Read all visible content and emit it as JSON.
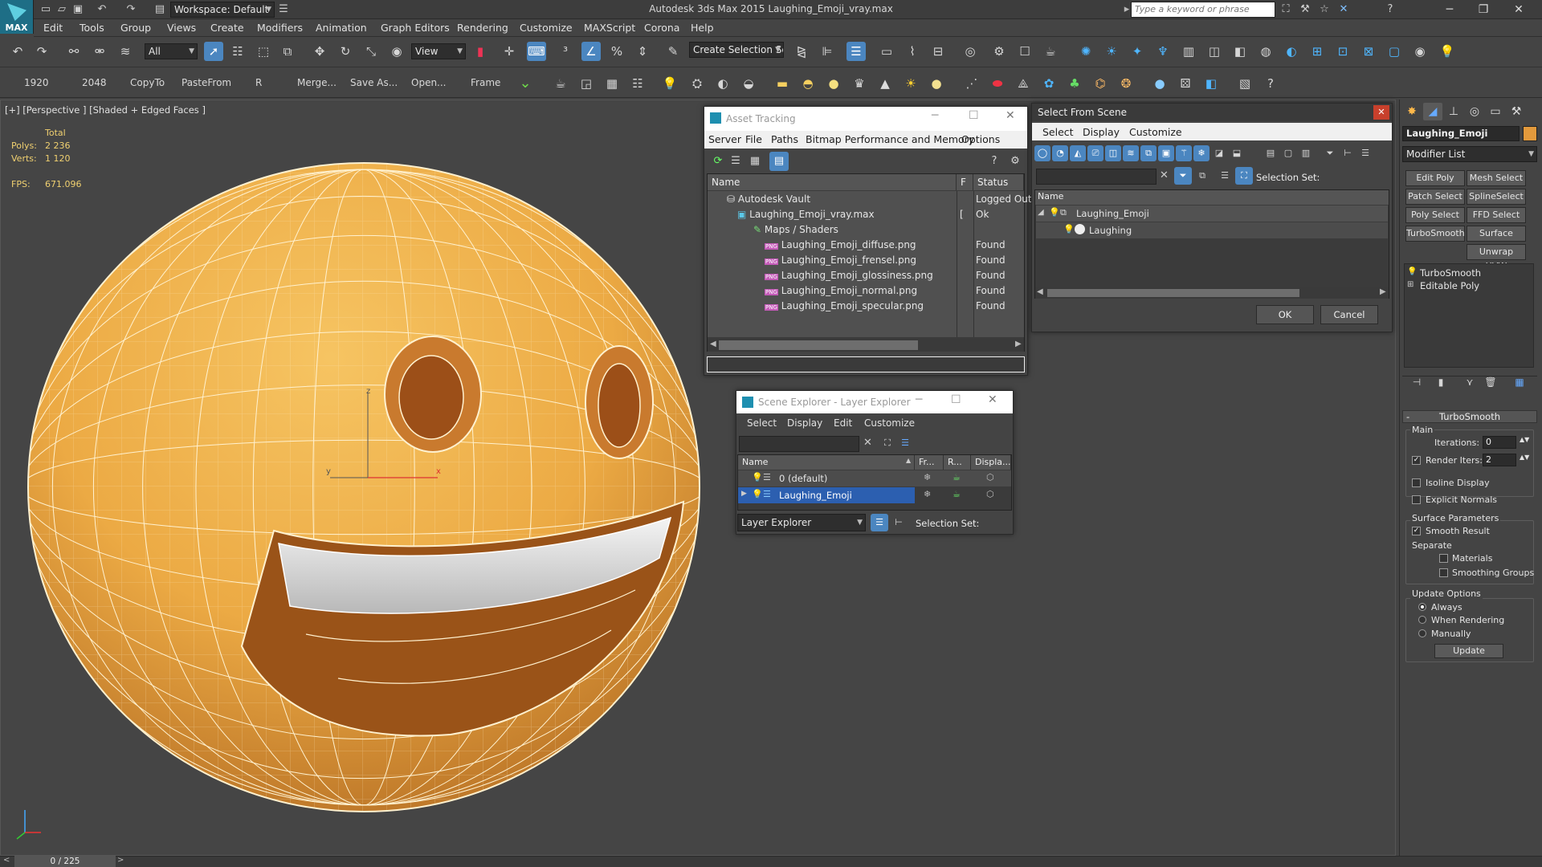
{
  "app": {
    "title": "Autodesk 3ds Max  2015     Laughing_Emoji_vray.max",
    "logo_text": "MAX",
    "workspace": "Workspace: Default",
    "search_placeholder": "Type a keyword or phrase"
  },
  "menu": [
    "Edit",
    "Tools",
    "Group",
    "Views",
    "Create",
    "Modifiers",
    "Animation",
    "Graph Editors",
    "Rendering",
    "Customize",
    "MAXScript",
    "Corona",
    "Help"
  ],
  "main_toolbar": {
    "filter": "All",
    "ref_coord": "View",
    "selection_set": "Create Selection Se"
  },
  "shelf": [
    "1920",
    "2048",
    "CopyTo",
    "PasteFrom",
    "R",
    "Merge...",
    "Save As...",
    "Open...",
    "Frame"
  ],
  "viewport": {
    "label": "[+] [Perspective ] [Shaded + Edged Faces ]",
    "stats_total": "Total",
    "polys_label": "Polys:",
    "polys": "2 236",
    "verts_label": "Verts:",
    "verts": "1 120",
    "fps_label": "FPS:",
    "fps": "671.096",
    "axis_x": "x",
    "axis_y": "y",
    "axis_z": "z"
  },
  "timeline": {
    "frame": "0 / 225"
  },
  "asset_tracking": {
    "title": "Asset Tracking",
    "menu": [
      "Server",
      "File",
      "Paths",
      "Bitmap Performance and Memory",
      "Options"
    ],
    "columns": [
      "Name",
      "F",
      "Status"
    ],
    "rows": [
      {
        "name": "Autodesk Vault",
        "f": "",
        "status": "Logged Out"
      },
      {
        "name": "Laughing_Emoji_vray.max",
        "f": "[",
        "status": "Ok"
      },
      {
        "name": "Maps / Shaders",
        "f": "",
        "status": ""
      },
      {
        "name": "Laughing_Emoji_diffuse.png",
        "f": "",
        "status": "Found"
      },
      {
        "name": "Laughing_Emoji_frensel.png",
        "f": "",
        "status": "Found"
      },
      {
        "name": "Laughing_Emoji_glossiness.png",
        "f": "",
        "status": "Found"
      },
      {
        "name": "Laughing_Emoji_normal.png",
        "f": "",
        "status": "Found"
      },
      {
        "name": "Laughing_Emoji_specular.png",
        "f": "",
        "status": "Found"
      }
    ],
    "file_icon_text": "PNG"
  },
  "select_from_scene": {
    "title": "Select From Scene",
    "menu": [
      "Select",
      "Display",
      "Customize"
    ],
    "selection_set_label": "Selection Set:",
    "col_name": "Name",
    "tree": [
      "Laughing_Emoji",
      "Laughing"
    ],
    "ok": "OK",
    "cancel": "Cancel"
  },
  "layer_explorer": {
    "title": "Scene Explorer - Layer Explorer",
    "menu": [
      "Select",
      "Display",
      "Edit",
      "Customize"
    ],
    "columns": [
      "Name",
      "Fr...",
      "R...",
      "Displa..."
    ],
    "rows": [
      "0 (default)",
      "Laughing_Emoji"
    ],
    "mode": "Layer Explorer",
    "selection_set_label": "Selection Set:"
  },
  "command_panel": {
    "object_name": "Laughing_Emoji",
    "object_color": "#e39a3c",
    "modifier_list": "Modifier List",
    "buttons": [
      "Edit Poly",
      "Mesh Select",
      "Patch Select",
      "SplineSelect",
      "Poly Select",
      "FFD Select",
      "TurboSmooth",
      "Surface Select",
      "Unwrap UVW"
    ],
    "stack": [
      "TurboSmooth",
      "Editable Poly"
    ],
    "rollout": "TurboSmooth",
    "main_label": "Main",
    "iterations_label": "Iterations:",
    "iterations": "0",
    "render_iters_label": "Render Iters:",
    "render_iters": "2",
    "isoline": "Isoline Display",
    "explicit_normals": "Explicit Normals",
    "surface_params": "Surface Parameters",
    "smooth_result": "Smooth Result",
    "separate": "Separate",
    "materials": "Materials",
    "smoothing_groups": "Smoothing Groups",
    "update_options": "Update Options",
    "always": "Always",
    "when_rendering": "When Rendering",
    "manually": "Manually",
    "update": "Update"
  },
  "colors": {
    "accent": "#4b86c0",
    "emoji": "#f0b24a",
    "selected": "#2c5fb0"
  }
}
